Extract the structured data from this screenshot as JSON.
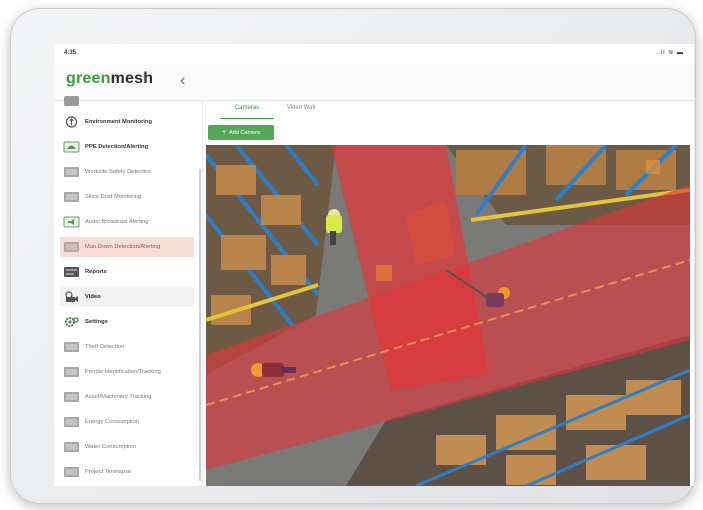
{
  "status": {
    "time": "4:35",
    "icons": "..ll ≋ ▬"
  },
  "brand": {
    "part1": "green",
    "part2": "mesh"
  },
  "nav": {
    "back_glyph": "‹"
  },
  "sidebar": {
    "items": [
      {
        "label": "",
        "icon": "partial-menu-icon",
        "state": "normal"
      },
      {
        "label": "Environment Monitoring",
        "icon": "leaf-circle-icon",
        "state": "bold"
      },
      {
        "label": "PPE Detection/Alerting",
        "icon": "helmet-icon",
        "state": "bold"
      },
      {
        "label": "Worksite Safety Detection",
        "icon": "safety-icon",
        "state": "normal"
      },
      {
        "label": "Silica Dust Monitoring",
        "icon": "dust-icon",
        "state": "normal"
      },
      {
        "label": "Audio Broadcast Alerting",
        "icon": "speaker-icon",
        "state": "normal"
      },
      {
        "label": "Man Down Detection/Alerting",
        "icon": "man-down-icon",
        "state": "highlight"
      },
      {
        "label": "Reports",
        "icon": "report-icon",
        "state": "bold"
      },
      {
        "label": "Video",
        "icon": "video-icon",
        "state": "active"
      },
      {
        "label": "Settings",
        "icon": "gear-icon",
        "state": "bold"
      },
      {
        "label": "Theft Detection",
        "icon": "theft-icon",
        "state": "normal"
      },
      {
        "label": "People Identification/Tracking",
        "icon": "people-icon",
        "state": "normal"
      },
      {
        "label": "Asset/Machinery Tracking",
        "icon": "asset-icon",
        "state": "normal"
      },
      {
        "label": "Energy Consumption",
        "icon": "energy-icon",
        "state": "normal"
      },
      {
        "label": "Water Consumption",
        "icon": "water-icon",
        "state": "normal"
      },
      {
        "label": "Project Timelapse",
        "icon": "timelapse-icon",
        "state": "normal"
      }
    ]
  },
  "tabs": [
    {
      "label": "Cameras",
      "active": true
    },
    {
      "label": "Video Wall",
      "active": false
    }
  ],
  "add_button": {
    "plus": "+",
    "label": "Add Camera"
  },
  "colors": {
    "brand_green": "#3a9b3f",
    "danger_zone": "#e0363a",
    "highlight_row": "#f7dcd7"
  }
}
